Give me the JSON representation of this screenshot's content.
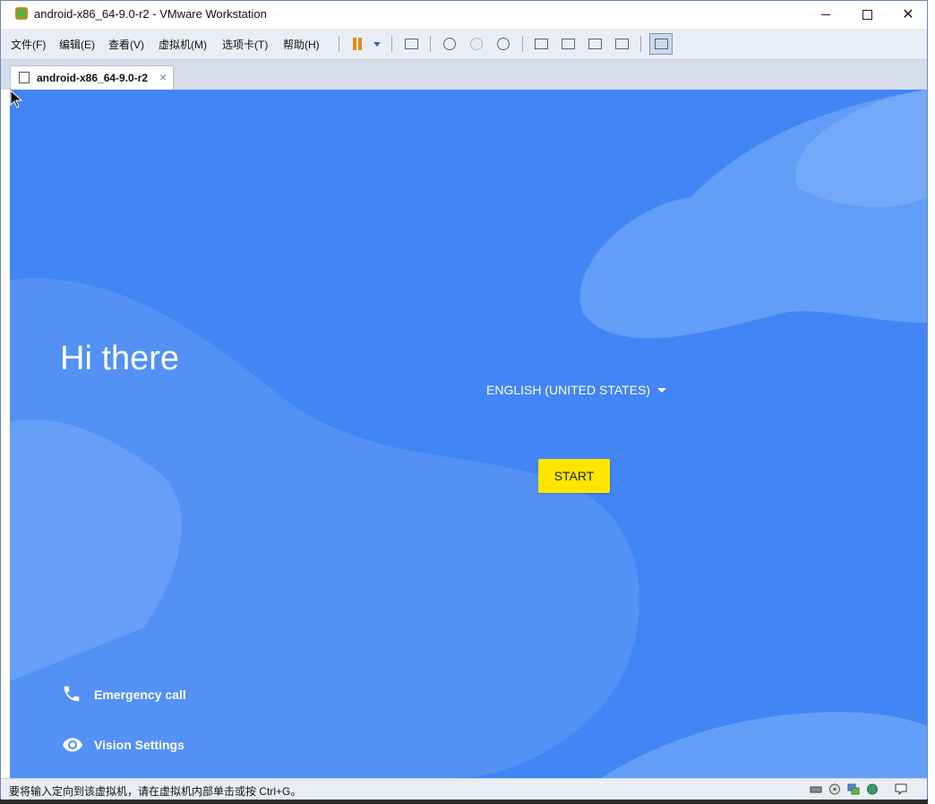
{
  "window": {
    "title": "android-x86_64-9.0-r2 - VMware Workstation"
  },
  "menu": {
    "items": [
      "文件(F)",
      "编辑(E)",
      "查看(V)",
      "虚拟机(M)",
      "选项卡(T)",
      "帮助(H)"
    ]
  },
  "toolbar": {
    "icons": [
      "pause-icon",
      "dropdown-icon",
      "send-keys-icon",
      "snapshot-take-icon",
      "snapshot-revert-icon",
      "snapshot-manager-icon",
      "library-icon",
      "console-icon",
      "fullscreen-icon",
      "unity-icon",
      "thumbnail-icon"
    ]
  },
  "tab": {
    "label": "android-x86_64-9.0-r2",
    "close": "×"
  },
  "android": {
    "greeting": "Hi there",
    "language": "ENGLISH (UNITED STATES)",
    "start_label": "START",
    "emergency_label": "Emergency call",
    "vision_label": "Vision Settings"
  },
  "colors": {
    "android_bg": "#4285f4",
    "start_button": "#ffe600",
    "wave_light": "#6aa3f7"
  },
  "status": {
    "message": "要将输入定向到该虚拟机，请在虚拟机内部单击或按 Ctrl+G。"
  }
}
